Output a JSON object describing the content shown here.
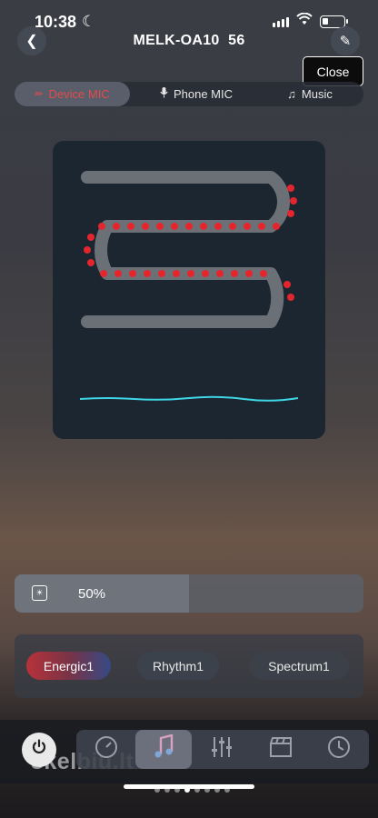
{
  "status": {
    "time": "10:38"
  },
  "header": {
    "device_name": "MELK-OA10",
    "device_number": "56",
    "close_label": "Close"
  },
  "mic_tabs": [
    {
      "label": "Device MIC",
      "active": true
    },
    {
      "label": "Phone MIC",
      "active": false
    },
    {
      "label": "Music",
      "active": false
    }
  ],
  "brightness": {
    "value": "50%",
    "level": 0.5
  },
  "modes": [
    {
      "label": "Energic1",
      "active": true
    },
    {
      "label": "Rhythm1",
      "active": false
    },
    {
      "label": "Spectrum1",
      "active": false
    }
  ],
  "nav": [
    {
      "icon": "dial-icon",
      "active": false
    },
    {
      "icon": "music-note-icon",
      "active": true
    },
    {
      "icon": "sliders-icon",
      "active": false
    },
    {
      "icon": "clapperboard-icon",
      "active": false
    },
    {
      "icon": "clock-icon",
      "active": false
    }
  ],
  "watermark": "skelbiu.lt",
  "colors": {
    "led_red": "#e3262e",
    "strip_gray": "#6b7077",
    "wave_cyan": "#3fd6e6",
    "active_tab_text": "#e24b4b"
  }
}
